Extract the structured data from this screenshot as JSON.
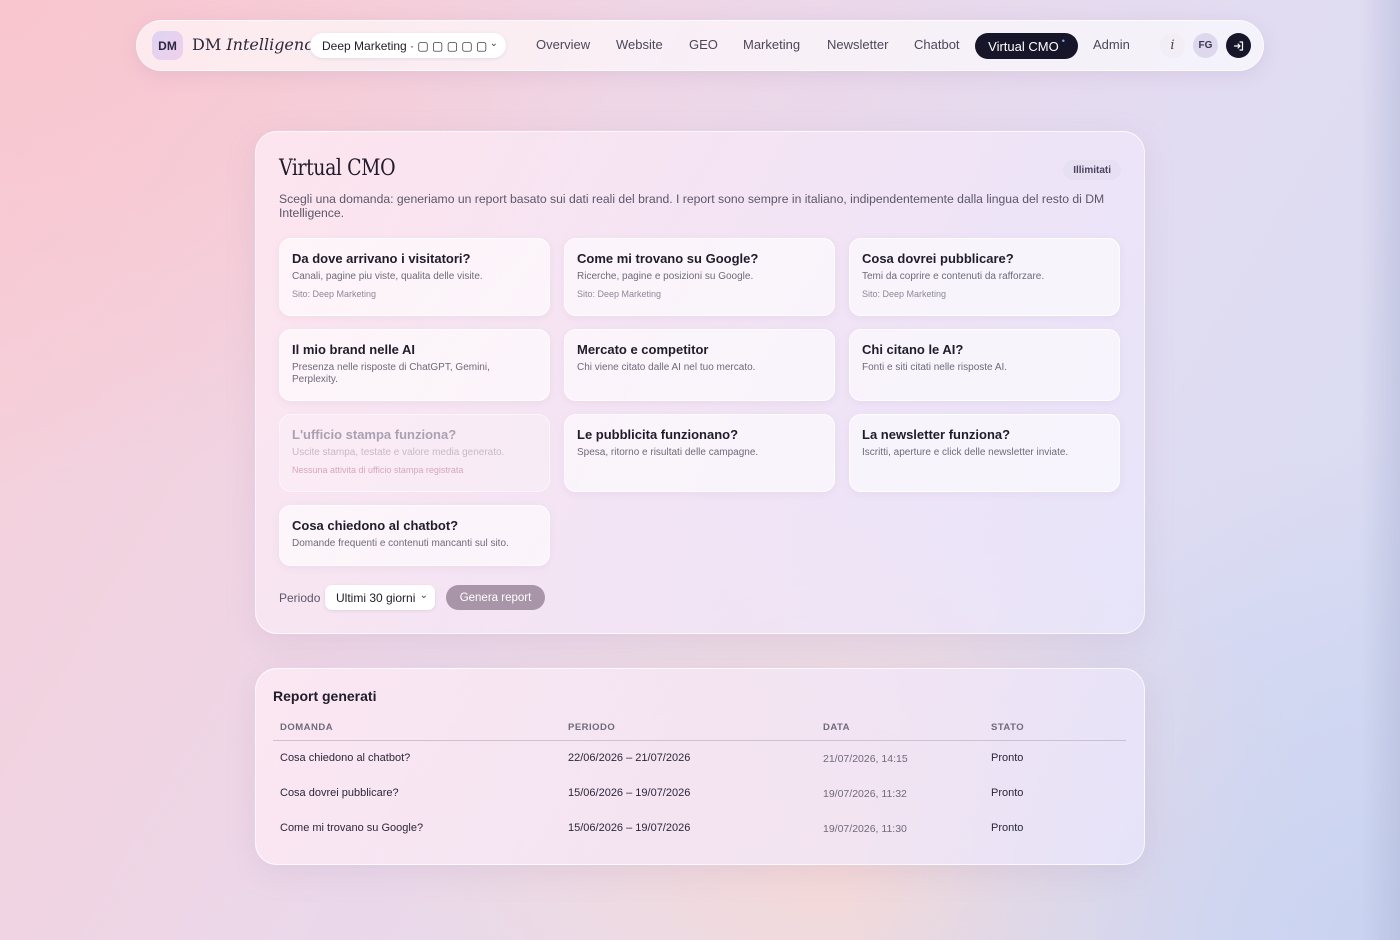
{
  "navbar": {
    "logo_initials": "DM",
    "logo_name": "DM",
    "logo_name_italic": "Intelligence",
    "site_selector": "Deep Marketing · ▢ ▢ ▢ ▢ ▢",
    "links": [
      "Overview",
      "Website",
      "GEO",
      "Marketing",
      "Newsletter",
      "Chatbot",
      "Virtual CMO",
      "Admin"
    ],
    "active_link": "Virtual CMO",
    "active_marker": "•",
    "info_label": "i",
    "user_initials": "FG",
    "logout_icon": "logout-icon"
  },
  "main": {
    "title": "Virtual CMO",
    "badge": "Illimitati",
    "description": "Scegli una domanda: generiamo un report basato sui dati reali del brand. I report sono sempre in italiano, indipendentemente dalla lingua del resto di DM Intelligence.",
    "questions": [
      {
        "title": "Da dove arrivano i visitatori?",
        "subtitle": "Canali, pagine piu viste, qualita delle visite.",
        "site": "Sito: Deep Marketing",
        "enabled": true
      },
      {
        "title": "Come mi trovano su Google?",
        "subtitle": "Ricerche, pagine e posizioni su Google.",
        "site": "Sito: Deep Marketing",
        "enabled": true
      },
      {
        "title": "Cosa dovrei pubblicare?",
        "subtitle": "Temi da coprire e contenuti da rafforzare.",
        "site": "Sito: Deep Marketing",
        "enabled": true
      },
      {
        "title": "Il mio brand nelle AI",
        "subtitle": "Presenza nelle risposte di ChatGPT, Gemini, Perplexity.",
        "site": "",
        "enabled": true
      },
      {
        "title": "Mercato e competitor",
        "subtitle": "Chi viene citato dalle AI nel tuo mercato.",
        "site": "",
        "enabled": true
      },
      {
        "title": "Chi citano le AI?",
        "subtitle": "Fonti e siti citati nelle risposte AI.",
        "site": "",
        "enabled": true
      },
      {
        "title": "L'ufficio stampa funziona?",
        "subtitle": "Uscite stampa, testate e valore media generato.",
        "site": "Nessuna attivita di ufficio stampa registrata",
        "enabled": false
      },
      {
        "title": "Le pubblicita funzionano?",
        "subtitle": "Spesa, ritorno e risultati delle campagne.",
        "site": "",
        "enabled": true
      },
      {
        "title": "La newsletter funziona?",
        "subtitle": "Iscritti, aperture e click delle newsletter inviate.",
        "site": "",
        "enabled": true
      },
      {
        "title": "Cosa chiedono al chatbot?",
        "subtitle": "Domande frequenti e contenuti mancanti sul sito.",
        "site": "",
        "enabled": true
      }
    ],
    "period_label": "Periodo",
    "period_value": "Ultimi 30 giorni",
    "generate_label": "Genera report"
  },
  "reports": {
    "title": "Report generati",
    "columns": [
      "DOMANDA",
      "PERIODO",
      "DATA",
      "STATO"
    ],
    "rows": [
      {
        "question": "Cosa chiedono al chatbot?",
        "period": "22/06/2026 – 21/07/2026",
        "date": "21/07/2026, 14:15",
        "status": "Pronto"
      },
      {
        "question": "Cosa dovrei pubblicare?",
        "period": "15/06/2026 – 19/07/2026",
        "date": "19/07/2026, 11:32",
        "status": "Pronto"
      },
      {
        "question": "Come mi trovano su Google?",
        "period": "15/06/2026 – 19/07/2026",
        "date": "19/07/2026, 11:30",
        "status": "Pronto"
      }
    ]
  }
}
